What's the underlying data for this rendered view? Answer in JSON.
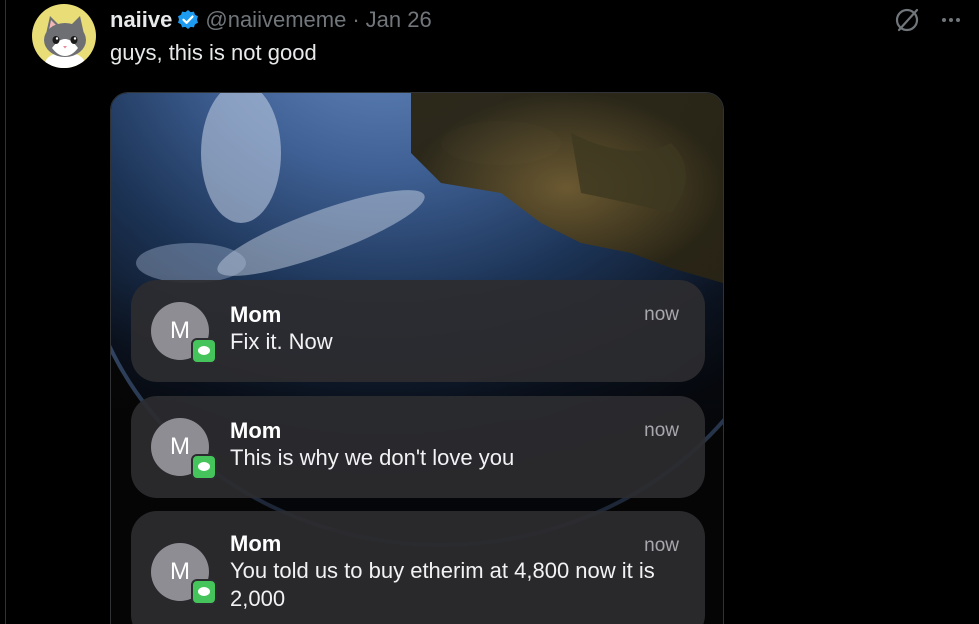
{
  "tweet": {
    "author_name": "naiive",
    "handle": "@naiivememe",
    "separator": "·",
    "date": "Jan 26",
    "text": "guys, this is not good",
    "avatar_icon": "cat-avatar",
    "verified_icon": "verified-badge-icon",
    "grok_icon": "grok-icon",
    "more_icon": "more-options-icon"
  },
  "notifications": [
    {
      "avatar_letter": "M",
      "sender": "Mom",
      "time": "now",
      "message": "Fix it. Now",
      "app_icon": "messages-icon"
    },
    {
      "avatar_letter": "M",
      "sender": "Mom",
      "time": "now",
      "message": "This is why we don't love you",
      "app_icon": "messages-icon"
    },
    {
      "avatar_letter": "M",
      "sender": "Mom",
      "time": "now",
      "message": "You told us to buy etherim at 4,800 now it is 2,000",
      "app_icon": "messages-icon"
    }
  ],
  "colors": {
    "background": "#000000",
    "primary_text": "#e7e9ea",
    "secondary_text": "#71767b",
    "verified": "#1d9bf0",
    "messages_green": "#44c45a",
    "avatar_yellow": "#e9dd77"
  }
}
